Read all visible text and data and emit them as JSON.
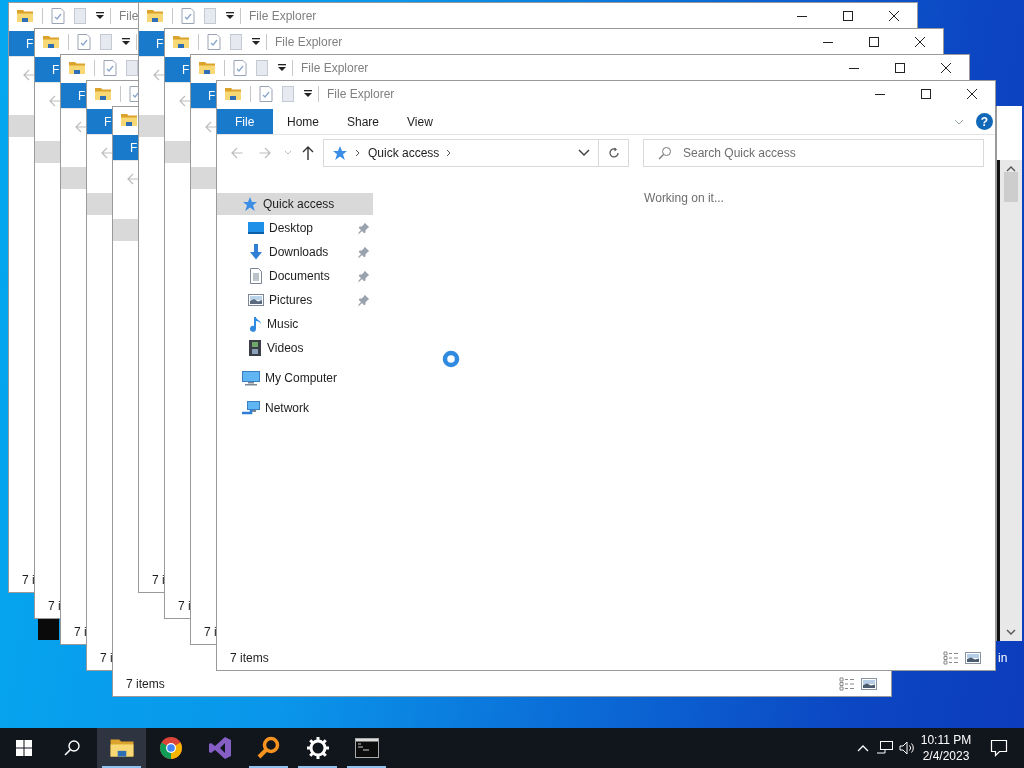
{
  "desktop": {
    "labels": [
      {
        "text": "in"
      }
    ]
  },
  "windows": [
    {
      "kind": "stacked",
      "title": "File",
      "ribbon_tabs": [
        {
          "label": "F",
          "kind": "menu"
        }
      ],
      "nav": [
        {
          "selected": true
        }
      ],
      "status": "7 i"
    },
    {
      "kind": "stacked",
      "ribbon_tabs": [
        {
          "label": "F",
          "kind": "menu"
        }
      ],
      "nav": [
        {
          "selected": true
        }
      ],
      "status": "7 i"
    },
    {
      "kind": "stacked",
      "ribbon_tabs": [
        {
          "label": "F",
          "kind": "menu"
        }
      ],
      "nav": [
        {
          "selected": true
        }
      ],
      "status": "7 i"
    },
    {
      "kind": "stacked",
      "ribbon_tabs": [
        {
          "label": "F",
          "kind": "menu"
        }
      ],
      "nav": [
        {
          "selected": true
        }
      ],
      "status": "7 i"
    },
    {
      "kind": "stacked-last",
      "ribbon_tabs": [
        {
          "label": "F",
          "kind": "menu"
        }
      ],
      "nav": [
        {
          "selected": true
        }
      ],
      "status": "7 items"
    },
    {
      "kind": "stacked-right",
      "title": "File Explorer",
      "ribbon_tabs": [
        {
          "label": "F",
          "kind": "menu"
        }
      ],
      "nav": [
        {
          "selected": true
        }
      ],
      "status": "7 i"
    },
    {
      "kind": "stacked-right",
      "title": "File Explorer",
      "ribbon_tabs": [
        {
          "label": "F",
          "kind": "menu"
        }
      ],
      "nav": [
        {
          "selected": true
        }
      ],
      "status": "7 i"
    },
    {
      "kind": "stacked-right",
      "title": "File Explorer",
      "ribbon_tabs": [
        {
          "label": "F",
          "kind": "menu"
        }
      ],
      "nav": [
        {
          "selected": true
        }
      ],
      "status": "7 i"
    },
    {
      "kind": "front",
      "title": "File Explorer",
      "ribbon_tabs": [
        {
          "label": "File",
          "kind": "menu"
        },
        {
          "label": "Home",
          "kind": "tab"
        },
        {
          "label": "Share",
          "kind": "tab"
        },
        {
          "label": "View",
          "kind": "tab"
        }
      ],
      "help_label": "?",
      "address": {
        "path": "Quick access"
      },
      "search": {
        "placeholder": "Search Quick access"
      },
      "nav": [
        {
          "label": "Quick access",
          "kind": "quick-access",
          "selected": true,
          "children": [
            {
              "label": "Desktop",
              "kind": "desktop",
              "selected": false,
              "pinned": true
            },
            {
              "label": "Downloads",
              "kind": "downloads",
              "selected": false,
              "pinned": true
            },
            {
              "label": "Documents",
              "kind": "documents",
              "selected": false,
              "pinned": true
            },
            {
              "label": "Pictures",
              "kind": "pictures",
              "selected": false,
              "pinned": true
            },
            {
              "label": "Music",
              "kind": "music",
              "selected": false,
              "pinned": false
            },
            {
              "label": "Videos",
              "kind": "videos",
              "selected": false,
              "pinned": false
            }
          ]
        },
        {
          "label": "My Computer",
          "kind": "computer",
          "selected": false
        },
        {
          "label": "Network",
          "kind": "network",
          "selected": false
        }
      ],
      "message": "Working on it...",
      "busy": true,
      "status": "7 items"
    }
  ],
  "taskbar": {
    "apps": [
      {
        "kind": "folder",
        "running": true,
        "active": true
      },
      {
        "kind": "browser",
        "running": false,
        "active": false
      },
      {
        "kind": "ribbon-logo",
        "running": false,
        "active": false
      },
      {
        "kind": "magnifier",
        "running": true,
        "active": false
      },
      {
        "kind": "gear",
        "running": true,
        "active": false
      },
      {
        "kind": "terminal",
        "running": true,
        "active": false
      }
    ],
    "clock": {
      "time": "10:11 PM",
      "date": "2/4/2023"
    }
  }
}
